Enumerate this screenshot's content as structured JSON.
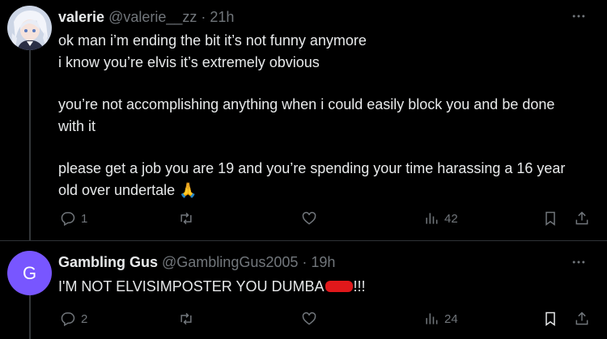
{
  "tweets": [
    {
      "name": "valerie",
      "handle": "@valerie__zz",
      "separator": "·",
      "time": "21h",
      "lines": [
        "ok man i’m ending the bit it’s not funny anymore",
        "i know you’re elvis it’s extremely obvious",
        "you’re not accomplishing anything when i could easily block you and be done with it",
        "please get a job you are 19 and you’re spending your time harassing a 16 year old over undertale 🙏"
      ],
      "replies": "1",
      "retweets": "",
      "likes": "",
      "views": "42"
    },
    {
      "avatar_letter": "G",
      "avatar_color": "#7856ff",
      "name": "Gambling Gus",
      "handle": "@GamblingGus2005",
      "separator": "·",
      "time": "19h",
      "text_before_redaction": "I'M NOT ELVISIMPOSTER YOU DUMBA",
      "text_after_redaction": "!!!",
      "replies": "2",
      "retweets": "",
      "likes": "",
      "views": "24"
    }
  ],
  "icons": {
    "reply": "reply-icon",
    "retweet": "retweet-icon",
    "like": "heart-icon",
    "views": "views-icon",
    "bookmark": "bookmark-icon",
    "share": "share-icon",
    "more": "more-icon"
  },
  "colors": {
    "background": "#000000",
    "text": "#e7e9ea",
    "muted": "#71767b",
    "divider": "#2f3336",
    "redaction": "#e0181b"
  }
}
